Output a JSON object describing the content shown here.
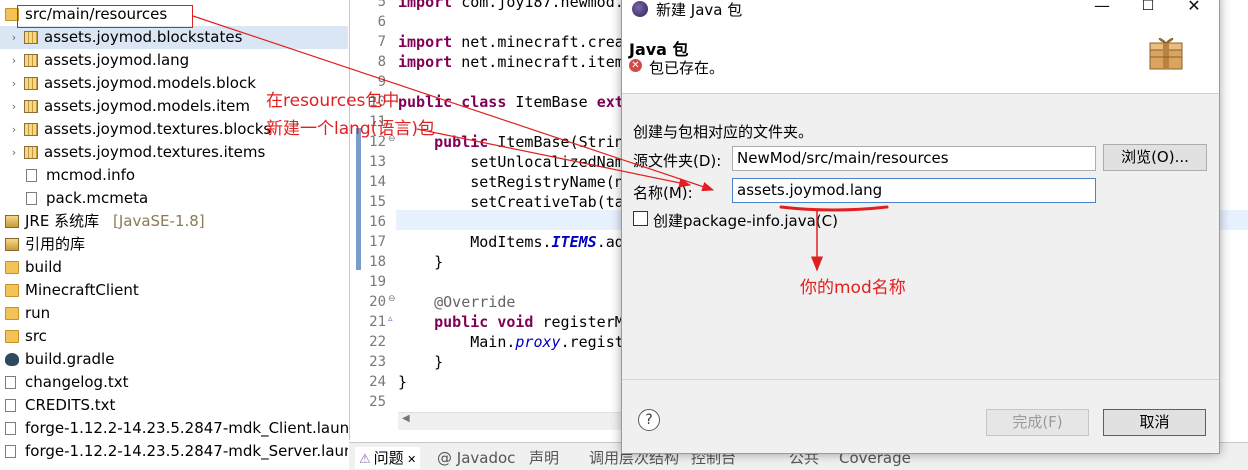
{
  "tree": {
    "items": [
      {
        "label": "src/main/resources",
        "kind": "folder",
        "expanded": true,
        "depth": 0
      },
      {
        "label": "assets.joymod.blockstates",
        "kind": "package",
        "depth": 1,
        "selected": true
      },
      {
        "label": "assets.joymod.lang",
        "kind": "package",
        "depth": 1
      },
      {
        "label": "assets.joymod.models.block",
        "kind": "package",
        "depth": 1
      },
      {
        "label": "assets.joymod.models.item",
        "kind": "package",
        "depth": 1
      },
      {
        "label": "assets.joymod.textures.blocks",
        "kind": "package",
        "depth": 1
      },
      {
        "label": "assets.joymod.textures.items",
        "kind": "package",
        "depth": 1
      },
      {
        "label": "mcmod.info",
        "kind": "file",
        "depth": 2
      },
      {
        "label": "pack.mcmeta",
        "kind": "file",
        "depth": 2
      },
      {
        "label": "JRE 系统库",
        "suffix": "[JavaSE-1.8]",
        "kind": "library",
        "depth": 0
      },
      {
        "label": "引用的库",
        "kind": "library",
        "depth": 0
      },
      {
        "label": "build",
        "kind": "folder",
        "depth": 0
      },
      {
        "label": "MinecraftClient",
        "kind": "folder",
        "depth": 0
      },
      {
        "label": "run",
        "kind": "folder",
        "depth": 0
      },
      {
        "label": "src",
        "kind": "folder",
        "depth": 0
      },
      {
        "label": "build.gradle",
        "kind": "gradle",
        "depth": 0
      },
      {
        "label": "changelog.txt",
        "kind": "file",
        "depth": 0
      },
      {
        "label": "CREDITS.txt",
        "kind": "file",
        "depth": 0
      },
      {
        "label": "forge-1.12.2-14.23.5.2847-mdk_Client.launch",
        "kind": "file",
        "depth": 0
      },
      {
        "label": "forge-1.12.2-14.23.5.2847-mdk_Server.launch",
        "kind": "file",
        "depth": 0
      }
    ]
  },
  "editor": {
    "lines": [
      {
        "num": "5",
        "html": "<span class=\"kw\">import</span> com.joy187.newmod."
      },
      {
        "num": "6",
        "html": ""
      },
      {
        "num": "7",
        "html": "<span class=\"kw\">import</span> net.minecraft.crea"
      },
      {
        "num": "8",
        "html": "<span class=\"kw\">import</span> net.minecraft.item"
      },
      {
        "num": "9",
        "html": ""
      },
      {
        "num": "10",
        "html": "<span class=\"kw\">public</span> <span class=\"kw\">class</span> ItemBase <span class=\"kw\">ext</span>"
      },
      {
        "num": "11",
        "html": ""
      },
      {
        "num": "12",
        "html": "    <span class=\"kw\">public</span> ItemBase(Strin"
      },
      {
        "num": "13",
        "html": "        setUnlocalizedNam"
      },
      {
        "num": "14",
        "html": "        setRegistryName(n"
      },
      {
        "num": "15",
        "html": "        setCreativeTab(ta"
      },
      {
        "num": "16",
        "html": ""
      },
      {
        "num": "17",
        "html": "        ModItems.<span class=\"fld\">ITEMS</span>.ad"
      },
      {
        "num": "18",
        "html": "    }"
      },
      {
        "num": "19",
        "html": ""
      },
      {
        "num": "20",
        "html": "    <span class=\"ann\">@Override</span>"
      },
      {
        "num": "21",
        "html": "    <span class=\"kw\">public</span> <span class=\"kw\">void</span> registerM"
      },
      {
        "num": "22",
        "html": "        Main.<span class=\"itl\">proxy</span>.regist"
      },
      {
        "num": "23",
        "html": "    }"
      },
      {
        "num": "24",
        "html": "}"
      },
      {
        "num": "25",
        "html": ""
      }
    ]
  },
  "bottom_tabs": [
    {
      "label": "问题",
      "icon": "⚠",
      "active": true
    },
    {
      "label": "@ Javadoc"
    },
    {
      "label": "声明"
    },
    {
      "label": "调用层次结构"
    },
    {
      "label": "控制台"
    },
    {
      "label": "公共"
    },
    {
      "label": "Coverage"
    }
  ],
  "dialog": {
    "title": "新建 Java 包",
    "heading": "Java 包",
    "error_message": "包已存在。",
    "description": "创建与包相对应的文件夹。",
    "source_folder_label": "源文件夹(D):",
    "source_folder_value": "NewMod/src/main/resources",
    "browse_label": "浏览(O)...",
    "name_label": "名称(M):",
    "name_value": "assets.joymod.lang",
    "checkbox_label": "创建package-info.java(C)",
    "finish_label": "完成(F)",
    "cancel_label": "取消",
    "help_symbol": "?",
    "minimize_symbol": "—",
    "maximize_symbol": "☐",
    "close_symbol": "✕"
  },
  "annotations": {
    "note1_line1": "在resources包中",
    "note1_line2": "新建一个lang(语言)包",
    "note2": "你的mod名称",
    "color": "#e02020"
  }
}
